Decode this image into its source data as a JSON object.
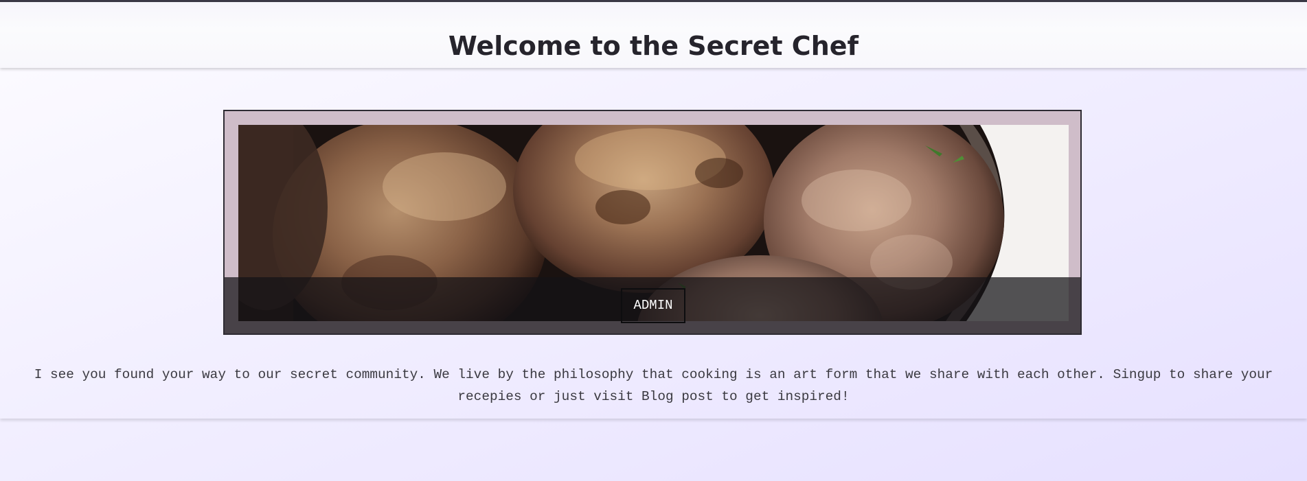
{
  "header": {
    "title": "Welcome to the Secret Chef"
  },
  "hero": {
    "image_subject": "meatballs-photo",
    "button_label": "ADMIN"
  },
  "intro": {
    "text": "I see you found your way to our secret community. We live by the philosophy that cooking is an art form that we share with each other. Singup to share your recepies or just visit Blog post to get inspired!"
  },
  "colors": {
    "page_background": "#f2efff",
    "frame_background": "#cfbdc9",
    "title_color": "#26242c",
    "overlay": "#141216",
    "text_color": "#3a3940"
  }
}
